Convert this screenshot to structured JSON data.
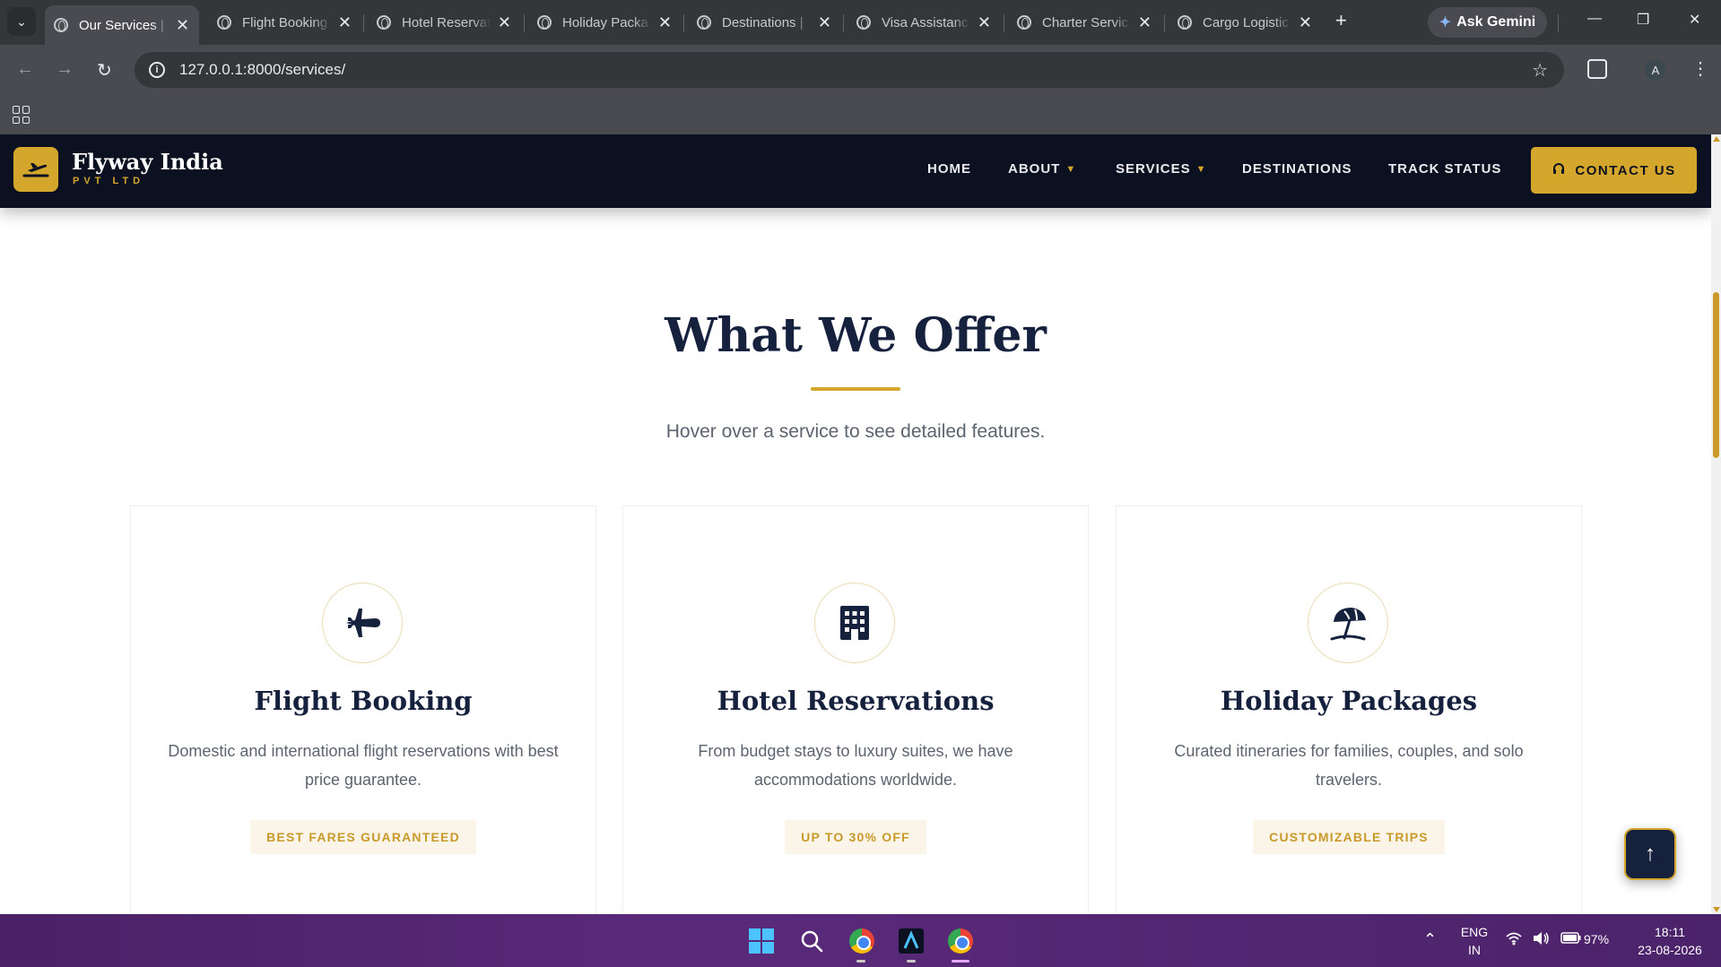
{
  "browser": {
    "tabs": [
      {
        "title": "Our Services |",
        "active": true
      },
      {
        "title": "Flight Booking",
        "active": false
      },
      {
        "title": "Hotel Reservat",
        "active": false
      },
      {
        "title": "Holiday Packa",
        "active": false
      },
      {
        "title": "Destinations |",
        "active": false
      },
      {
        "title": "Visa Assistanc",
        "active": false
      },
      {
        "title": "Charter Servic",
        "active": false
      },
      {
        "title": "Cargo Logistic",
        "active": false
      }
    ],
    "gemini_label": "Ask Gemini",
    "url": "127.0.0.1:8000/services/",
    "profile_initial": "A"
  },
  "site": {
    "brand": {
      "name": "Flyway India",
      "sub": "PVT LTD"
    },
    "nav": {
      "home": "HOME",
      "about": "ABOUT",
      "services": "SERVICES",
      "destinations": "DESTINATIONS",
      "track": "TRACK STATUS",
      "contact": "CONTACT US"
    },
    "section": {
      "title": "What We Offer",
      "subtitle": "Hover over a service to see detailed features."
    },
    "cards": [
      {
        "icon": "airplane-icon",
        "title": "Flight Booking",
        "desc": "Domestic and international flight reservations with best price guarantee.",
        "badge": "BEST FARES GUARANTEED"
      },
      {
        "icon": "hotel-building-icon",
        "title": "Hotel Reservations",
        "desc": "From budget stays to luxury suites, we have accommodations worldwide.",
        "badge": "UP TO 30% OFF"
      },
      {
        "icon": "beach-umbrella-icon",
        "title": "Holiday Packages",
        "desc": "Curated itineraries for families, couples, and solo travelers.",
        "badge": "CUSTOMIZABLE TRIPS"
      }
    ],
    "colors": {
      "navy": "#0b1120",
      "gold": "#d4a72c",
      "heading": "#16213e"
    }
  },
  "taskbar": {
    "lang_top": "ENG",
    "lang_bottom": "IN",
    "battery": "97%",
    "time": "18:11",
    "date": "23-08-2026"
  }
}
